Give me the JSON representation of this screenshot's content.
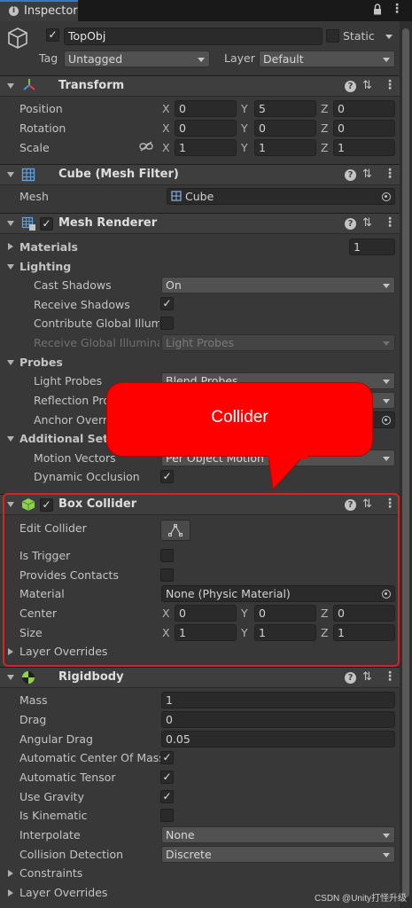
{
  "window": {
    "tab_label": "Inspector",
    "lock_icon": "lock-icon",
    "menu_icon": "kebab-icon"
  },
  "object": {
    "name": "TopObj",
    "active": true,
    "static_label": "Static",
    "static_checked": false,
    "tag_label": "Tag",
    "tag_value": "Untagged",
    "layer_label": "Layer",
    "layer_value": "Default"
  },
  "transform": {
    "title": "Transform",
    "rows": [
      {
        "label": "Position",
        "x": "0",
        "y": "5",
        "z": "0"
      },
      {
        "label": "Rotation",
        "x": "0",
        "y": "0",
        "z": "0"
      },
      {
        "label": "Scale",
        "x": "1",
        "y": "1",
        "z": "1"
      }
    ]
  },
  "axis": {
    "x": "X",
    "y": "Y",
    "z": "Z"
  },
  "mesh_filter": {
    "title": "Cube (Mesh Filter)",
    "mesh_label": "Mesh",
    "mesh_value": "Cube"
  },
  "mesh_renderer": {
    "title": "Mesh Renderer",
    "materials_label": "Materials",
    "materials_count": "1",
    "lighting_label": "Lighting",
    "cast_shadows_label": "Cast Shadows",
    "cast_shadows_value": "On",
    "receive_shadows_label": "Receive Shadows",
    "contribute_gi_label": "Contribute Global Illumi",
    "receive_gi_label": "Receive Global Illumina",
    "receive_gi_value": "Light Probes",
    "probes_label": "Probes",
    "light_probes_label": "Light Probes",
    "light_probes_value": "Blend Probes",
    "reflection_probes_label": "Reflection Pro",
    "anchor_override_label": "Anchor Overri",
    "additional_label": "Additional Setti",
    "motion_vectors_label": "Motion Vectors",
    "motion_vectors_value": "Per Object Motion",
    "dynamic_occlusion_label": "Dynamic Occlusion"
  },
  "callout": {
    "text": "Collider",
    "color": "#ff0000"
  },
  "box_collider": {
    "title": "Box Collider",
    "edit_collider_label": "Edit Collider",
    "is_trigger_label": "Is Trigger",
    "provides_contacts_label": "Provides Contacts",
    "material_label": "Material",
    "material_value": "None (Physic Material)",
    "center_label": "Center",
    "center": {
      "x": "0",
      "y": "0",
      "z": "0"
    },
    "size_label": "Size",
    "size": {
      "x": "1",
      "y": "1",
      "z": "1"
    },
    "layer_overrides_label": "Layer Overrides"
  },
  "rigidbody": {
    "title": "Rigidbody",
    "mass_label": "Mass",
    "mass_value": "1",
    "drag_label": "Drag",
    "drag_value": "0",
    "angular_drag_label": "Angular Drag",
    "angular_drag_value": "0.05",
    "auto_com_label": "Automatic Center Of Mass",
    "auto_tensor_label": "Automatic Tensor",
    "use_gravity_label": "Use Gravity",
    "is_kinematic_label": "Is Kinematic",
    "interpolate_label": "Interpolate",
    "interpolate_value": "None",
    "collision_detection_label": "Collision Detection",
    "collision_detection_value": "Discrete",
    "constraints_label": "Constraints",
    "layer_overrides_label": "Layer Overrides"
  },
  "watermark": "CSDN @Unity打怪升级",
  "colors": {
    "highlight": "#e02020",
    "panel_bg": "#383838",
    "accent": "#3a79bb"
  }
}
